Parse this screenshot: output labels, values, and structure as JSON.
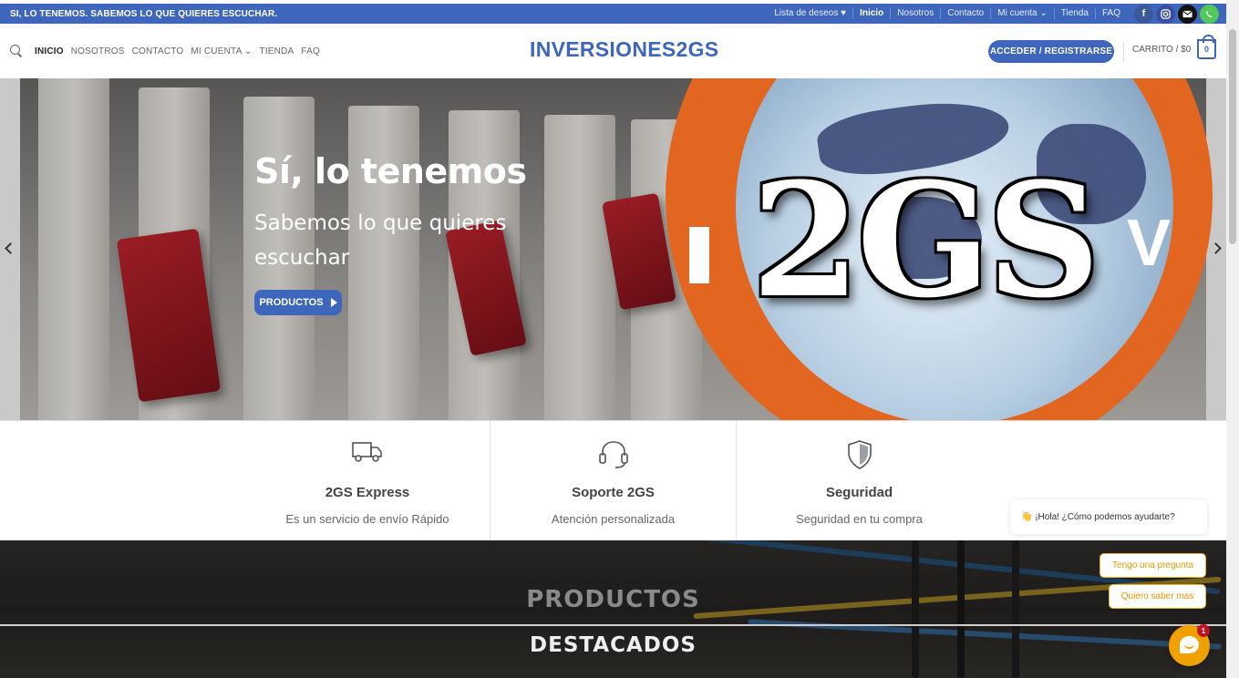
{
  "topbar": {
    "message": "SI, LO TENEMOS. SABEMOS LO QUE QUIERES ESCUCHAR.",
    "links": [
      "Lista de deseos ♥",
      "Inicio",
      "Nosotros",
      "Contacto",
      "Mi cuenta ⌄",
      "Tienda",
      "FAQ"
    ],
    "social": [
      "facebook-icon",
      "instagram-icon",
      "email-icon",
      "whatsapp-icon"
    ]
  },
  "header": {
    "nav": [
      "INICIO",
      "NOSOTROS",
      "CONTACTO",
      "MI CUENTA ⌄",
      "TIENDA",
      "FAQ"
    ],
    "logo": "INVERSIONES2GS",
    "login_label": "ACCEDER / REGISTRARSE",
    "cart_label": "CARRITO / $0",
    "cart_count": "0"
  },
  "hero": {
    "title": "Sí, lo tenemos",
    "subtitle": "Sabemos lo que quieres escuchar",
    "button_label": "PRODUCTOS",
    "logo_text": "2GS",
    "side_left": "I",
    "side_right": "V"
  },
  "features": [
    {
      "title": "2GS Express",
      "desc": "Es un servicio de envío Rápido",
      "icon": "truck-icon"
    },
    {
      "title": "Soporte 2GS",
      "desc": "Atención personalizada",
      "icon": "headset-icon"
    },
    {
      "title": "Seguridad",
      "desc": "Seguridad en tu compra",
      "icon": "shield-icon"
    }
  ],
  "products": {
    "title1": "PRODUCTOS",
    "title2": "DESTACADOS"
  },
  "chat": {
    "greeting": "👋 ¡Hola! ¿Cómo podemos ayudarte?",
    "option1": "Tengo una pregunta",
    "option2": "Quiero saber mas",
    "badge": "1"
  },
  "colors": {
    "brand": "#3f66bd",
    "accent_orange": "#e2661f",
    "chat_yellow": "#f0a000"
  }
}
